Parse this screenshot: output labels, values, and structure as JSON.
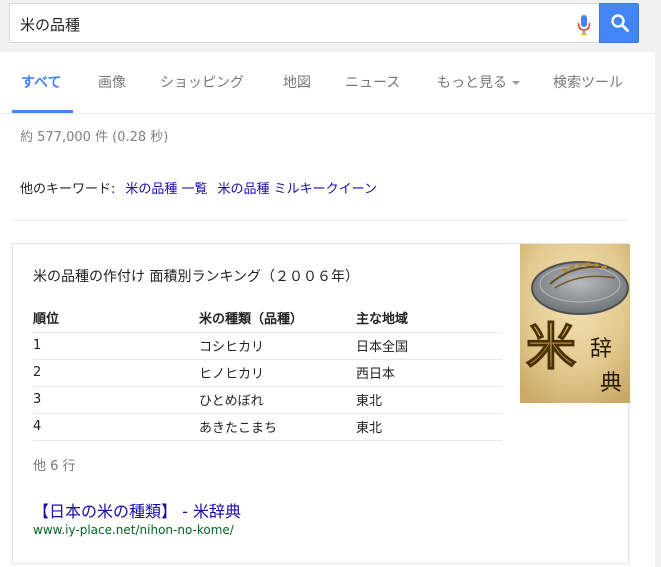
{
  "search": {
    "query": "米の品種"
  },
  "tabs": [
    {
      "label": "すべて",
      "active": true
    },
    {
      "label": "画像"
    },
    {
      "label": "ショッピング"
    },
    {
      "label": "地図"
    },
    {
      "label": "ニュース"
    },
    {
      "label": "もっと見る"
    },
    {
      "label": "検索ツール"
    }
  ],
  "results": {
    "stats": "約 577,000 件  (0.28 秒)",
    "keywords_label": "他のキーワード:",
    "keywords": [
      "米の品種 一覧",
      "米の品種 ミルキークイーン"
    ]
  },
  "card": {
    "title": "米の品種の作付け 面積別ランキング（２００６年）",
    "headers": [
      "順位",
      "米の種類（品種）",
      "主な地域"
    ],
    "rows": [
      [
        "1",
        "コシヒカリ",
        "日本全国"
      ],
      [
        "2",
        "ヒノヒカリ",
        "西日本"
      ],
      [
        "3",
        "ひとめぼれ",
        "東北"
      ],
      [
        "4",
        "あきたこまち",
        "東北"
      ]
    ],
    "more_rows": "他 6 行",
    "source_title": "【日本の米の種類】 - 米辞典",
    "source_url": "www.iy-place.net/nihon-no-kome/",
    "thumb_text": [
      "米",
      "辞",
      "典"
    ]
  },
  "colors": {
    "accent": "#4285f4",
    "link": "#1a0dab",
    "url_green": "#006621"
  }
}
